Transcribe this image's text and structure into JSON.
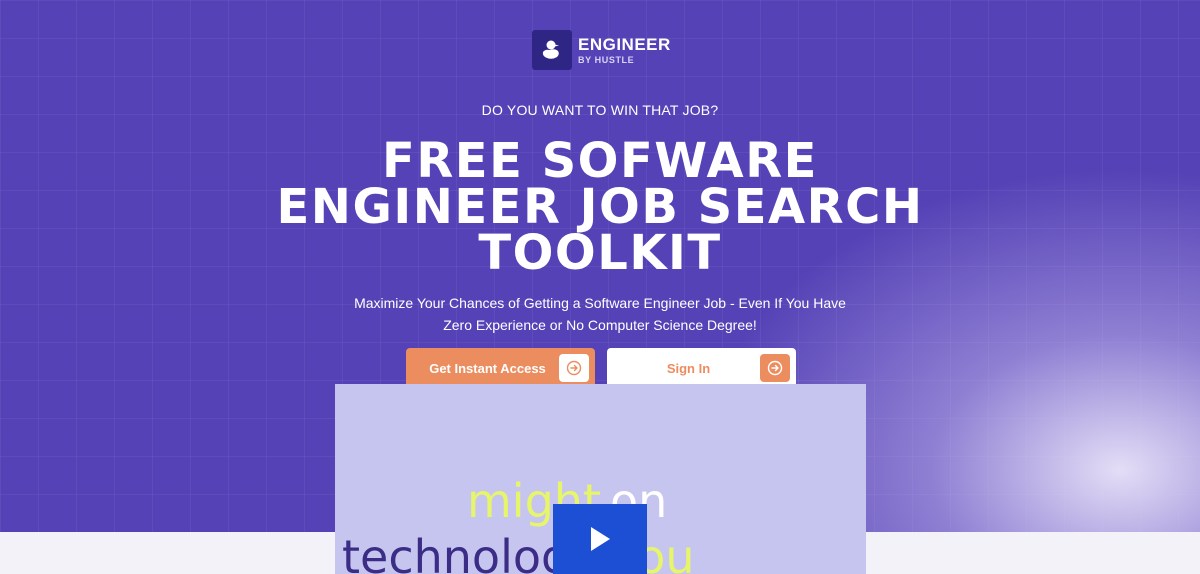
{
  "brand": {
    "title": "ENGINEER",
    "subtitle": "BY HUSTLE"
  },
  "hero": {
    "eyebrow": "DO YOU WANT TO WIN THAT JOB?",
    "headline": "FREE SOFWARE ENGINEER JOB SEARCH TOOLKIT",
    "subheadline": "Maximize Your Chances of Getting a Software Engineer Job - Even If You Have Zero Experience or No Computer Science Degree!"
  },
  "buttons": {
    "primary_label": "Get Instant Access",
    "secondary_label": "Sign In"
  },
  "video": {
    "words": [
      "might",
      "on",
      "technologies",
      "you"
    ]
  },
  "colors": {
    "hero_bg": "#5542b6",
    "accent": "#ec8d5f",
    "logo_box": "#2e2585",
    "video_bg": "#c6c5ef",
    "play_button": "#1c4fd4"
  },
  "icons": {
    "logo": "duck-icon",
    "button_arrow": "arrow-circle-right-icon",
    "play": "play-icon"
  }
}
